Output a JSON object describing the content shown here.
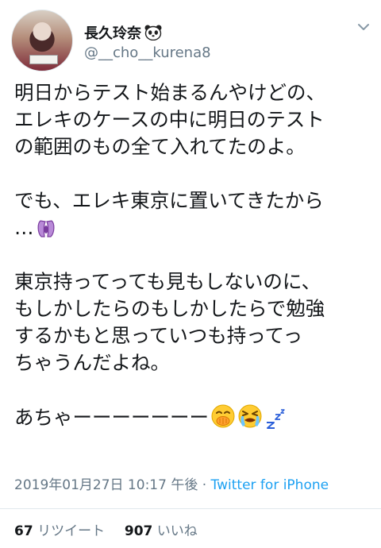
{
  "user": {
    "display_name": "長久玲奈",
    "username": "@__cho__kurena8",
    "avatar_icon": "profile-photo",
    "name_emoji_icon": "panda-face-icon"
  },
  "tweet": {
    "lines": [
      "明日からテスト始まるんやけどの、",
      "エレキのケースの中に明日のテスト",
      "の範囲のもの全て入れてたのよ。",
      "",
      "でも、エレキ東京に置いてきたから",
      "…",
      "",
      "東京持ってっても見もしないのに、",
      "もしかしたらのもしかしたらで勉強",
      "するかもと思っていつも持ってっ",
      "ちゃうんだよね。",
      "",
      "あちゃーーーーーーー"
    ],
    "emoji_icons": [
      "screaming-face-icon",
      "hand-over-mouth-face-icon",
      "crying-face-icon",
      "sleeping-zzz-icon"
    ]
  },
  "meta": {
    "timestamp": "2019年01月27日 10:17 午後",
    "separator": "·",
    "source": "Twitter for iPhone"
  },
  "stats": {
    "retweets_count": "67",
    "retweets_label": "リツイート",
    "likes_count": "907",
    "likes_label": "いいね"
  },
  "colors": {
    "text": "#14171a",
    "muted": "#657786",
    "link": "#1da1f2",
    "divider": "#e1e8ed"
  }
}
